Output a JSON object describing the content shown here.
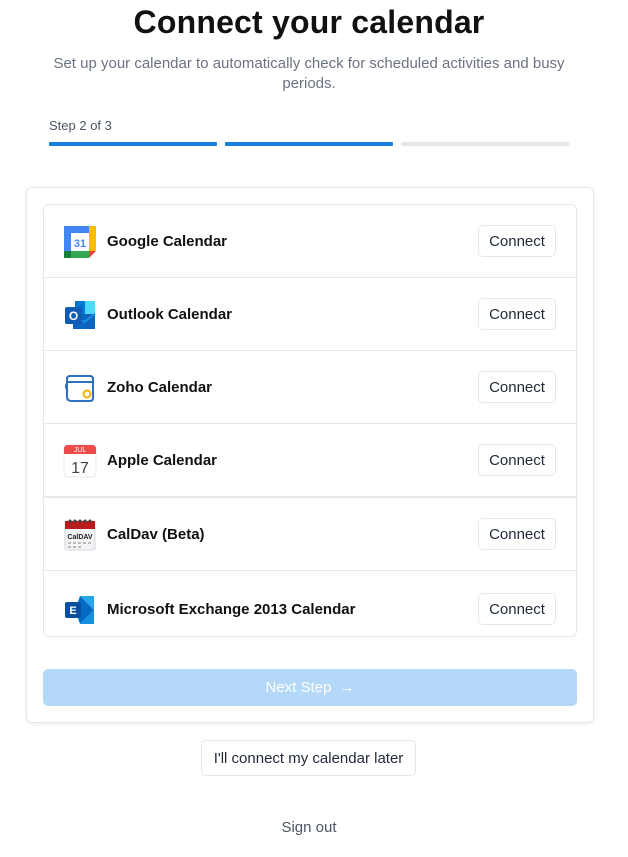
{
  "header": {
    "title": "Connect your calendar",
    "subtitle": "Set up your calendar to automatically check for scheduled activities and busy periods."
  },
  "progress": {
    "label": "Step 2 of 3",
    "current_step": 2,
    "total_steps": 3,
    "active_color": "#1b7fdc",
    "inactive_color": "#e5e7eb"
  },
  "calendars": [
    {
      "name": "Google Calendar",
      "icon": "google-calendar-icon",
      "button": "Connect"
    },
    {
      "name": "Outlook Calendar",
      "icon": "outlook-icon",
      "button": "Connect"
    },
    {
      "name": "Zoho Calendar",
      "icon": "zoho-calendar-icon",
      "button": "Connect"
    },
    {
      "name": "Apple Calendar",
      "icon": "apple-calendar-icon",
      "button": "Connect"
    },
    {
      "name": "CalDav (Beta)",
      "icon": "caldav-icon",
      "button": "Connect"
    },
    {
      "name": "Microsoft Exchange 2013 Calendar",
      "icon": "exchange-icon",
      "button": "Connect"
    }
  ],
  "icon_text": {
    "google_day": "31",
    "outlook_letter": "O",
    "apple_month": "JUL",
    "apple_day": "17",
    "caldav_label": "CalDAV",
    "exchange_letter": "E"
  },
  "actions": {
    "next_step": "Next Step",
    "next_arrow": "→",
    "connect_later": "I'll connect my calendar later",
    "sign_out": "Sign out"
  },
  "colors": {
    "next_button_disabled": "#b3d8f8",
    "accent": "#1b7fdc"
  }
}
